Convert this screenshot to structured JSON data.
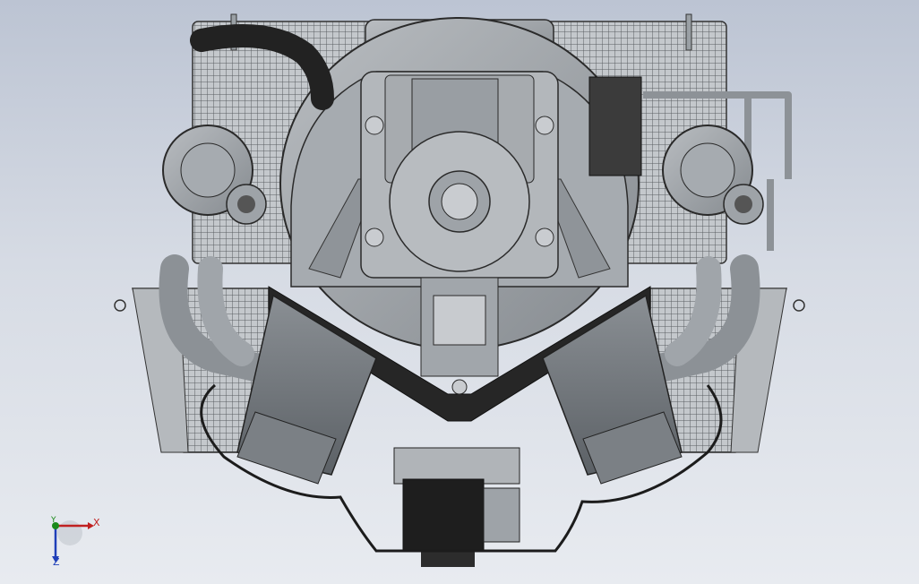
{
  "viewport": {
    "background_top": "#bcc4d3",
    "background_bottom": "#e8ebf0"
  },
  "model": {
    "line_color": "#2a2a2a",
    "metal_fill": "#9ea3a8",
    "hose_fill": "#2b2b2b",
    "radiator_fill": "#bfc3c7"
  },
  "triad": {
    "x_label": "X",
    "y_label": "Y",
    "z_label": "Z",
    "x_color": "#c02020",
    "y_color": "#1a8a1a",
    "z_color": "#1f3fb8"
  }
}
